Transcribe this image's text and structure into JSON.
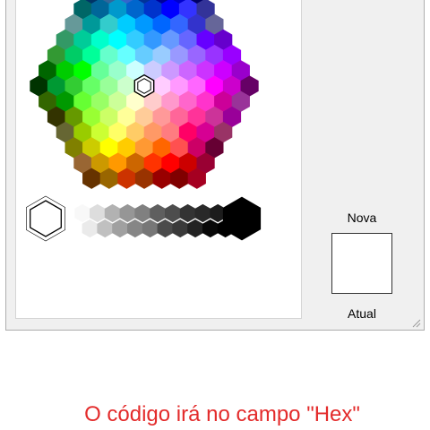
{
  "dialog": {
    "new_label": "Nova",
    "current_label": "Atual",
    "new_color": "#ffffff",
    "current_color": "#ffffff"
  },
  "palette": {
    "honeycomb_rows": [
      [
        "#003366",
        "#336699",
        "#3366cc",
        "#003399",
        "#000099",
        "#0000cc",
        "#000066"
      ],
      [
        "#006666",
        "#006699",
        "#0099cc",
        "#0066cc",
        "#0033cc",
        "#0000ff",
        "#3333ff",
        "#333399"
      ],
      [
        "#669999",
        "#009999",
        "#33cccc",
        "#00ccff",
        "#0099ff",
        "#0066ff",
        "#3366ff",
        "#3333cc",
        "#666699"
      ],
      [
        "#339966",
        "#00cc99",
        "#00ffcc",
        "#00ffff",
        "#33ccff",
        "#3399ff",
        "#6699ff",
        "#6666ff",
        "#6600ff",
        "#6600cc"
      ],
      [
        "#339933",
        "#00cc66",
        "#00ff99",
        "#66ffcc",
        "#66ffff",
        "#66ccff",
        "#99ccff",
        "#9999ff",
        "#9966ff",
        "#9933ff",
        "#9900ff"
      ],
      [
        "#006600",
        "#00cc00",
        "#00ff00",
        "#66ff99",
        "#99ffcc",
        "#ccffff",
        "#ccccff",
        "#cc99ff",
        "#cc66ff",
        "#cc33ff",
        "#cc00ff",
        "#9900cc"
      ],
      [
        "#003300",
        "#009933",
        "#33cc33",
        "#66ff66",
        "#99ff99",
        "#ccffcc",
        "#ffffff",
        "#ffccff",
        "#ff99ff",
        "#ff66ff",
        "#ff00ff",
        "#cc00cc",
        "#660066"
      ],
      [
        "#336600",
        "#009900",
        "#66ff33",
        "#99ff66",
        "#ccff99",
        "#ffffcc",
        "#ffcccc",
        "#ff99cc",
        "#ff66cc",
        "#ff33cc",
        "#cc0099",
        "#993399"
      ],
      [
        "#333300",
        "#669900",
        "#99ff33",
        "#ccff66",
        "#ffff99",
        "#ffcc99",
        "#ff9999",
        "#ff6699",
        "#ff3399",
        "#cc3399",
        "#990099"
      ],
      [
        "#666633",
        "#99cc00",
        "#ccff33",
        "#ffff66",
        "#ffcc66",
        "#ff9966",
        "#ff7c80",
        "#ff0066",
        "#d60093",
        "#993366"
      ],
      [
        "#808000",
        "#cccc00",
        "#ffff00",
        "#ffcc00",
        "#ff9933",
        "#ff6600",
        "#ff5050",
        "#cc0066",
        "#660033"
      ],
      [
        "#996633",
        "#cc9900",
        "#ff9900",
        "#cc6600",
        "#ff3300",
        "#ff0000",
        "#cc0000",
        "#990033"
      ],
      [
        "#663300",
        "#996600",
        "#cc3300",
        "#993300",
        "#990000",
        "#800000",
        "#a50021"
      ]
    ],
    "gray_top": [
      "#f8f8f8",
      "#dddddd",
      "#b2b2b2",
      "#969696",
      "#808080",
      "#5f5f5f",
      "#4d4d4d",
      "#333333",
      "#292929",
      "#1c1c1c",
      "#111111"
    ],
    "gray_bottom": [
      "#eaeaea",
      "#c0c0c0",
      "#a0a0a0",
      "#868686",
      "#777777",
      "#4b4b4b",
      "#3a3a3a",
      "#222222",
      "#080808",
      "#000000"
    ],
    "white_large": "#ffffff",
    "black_large": "#000000"
  },
  "caption": "O código irá no campo \"Hex\""
}
